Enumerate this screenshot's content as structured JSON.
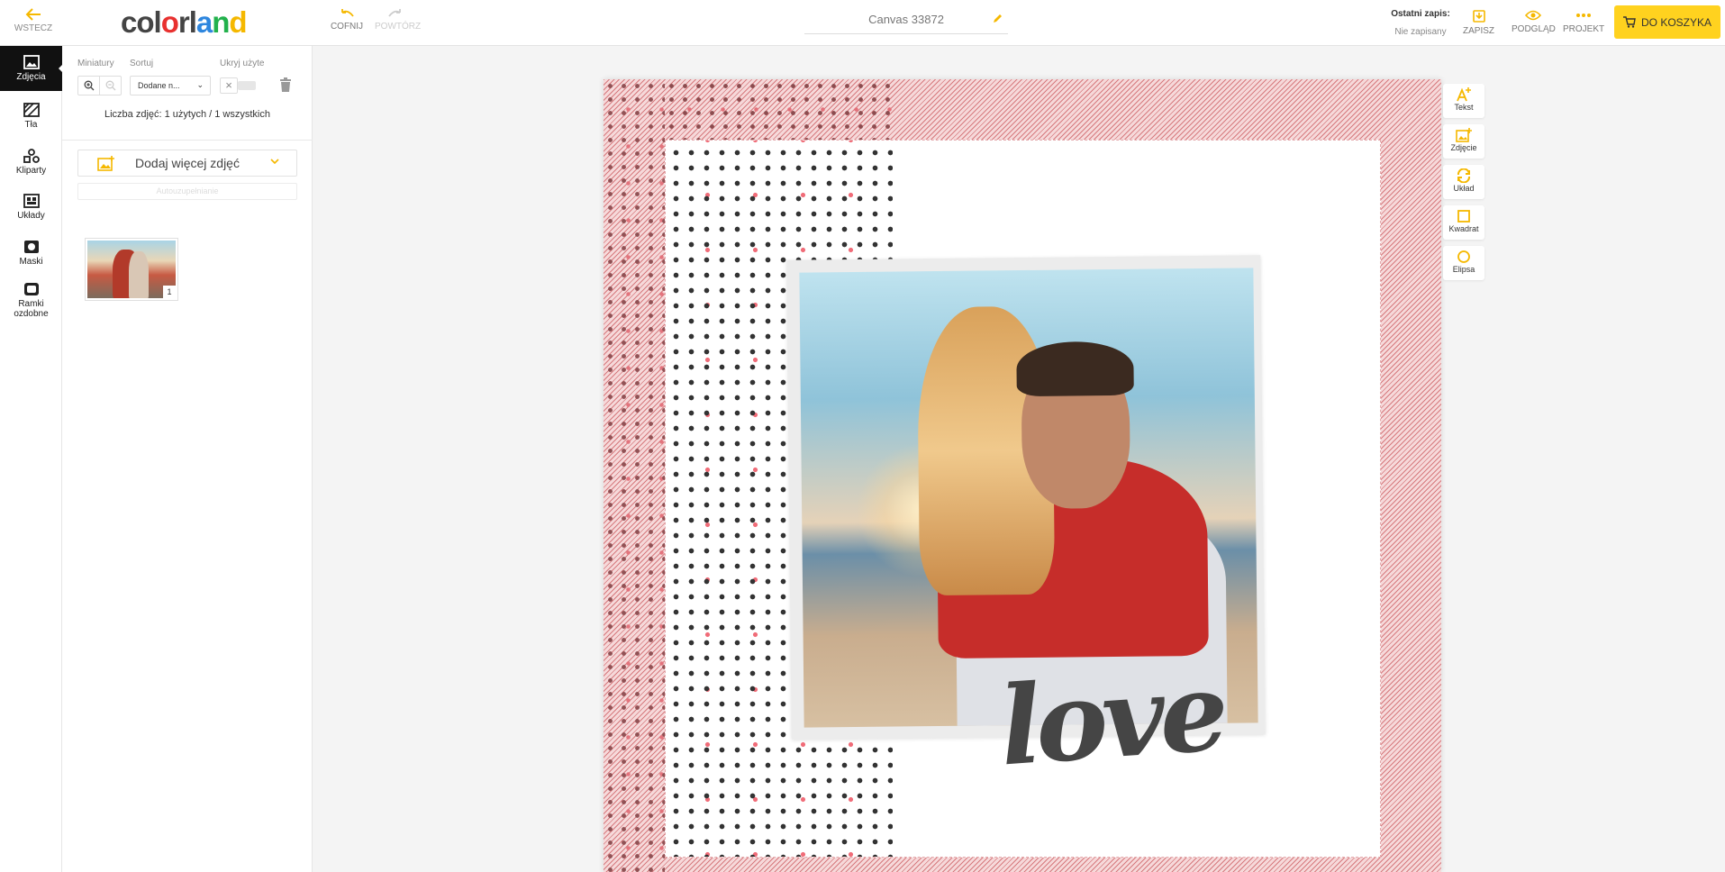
{
  "header": {
    "back_label": "WSTECZ",
    "logo": {
      "c1": "co",
      "o": "l",
      "c2": "o",
      "r": "r",
      "l": "l",
      "a": "a",
      "n": "n",
      "d": "d"
    },
    "undo_label": "COFNIJ",
    "redo_label": "POWTÓRZ",
    "canvas_name": "Canvas 33872",
    "last_save_title": "Ostatni zapis:",
    "last_save_value": "Nie zapisany",
    "save_label": "ZAPISZ",
    "preview_label": "PODGLĄD",
    "project_label": "PROJEKT",
    "cart_label": "DO KOSZYKA"
  },
  "sidebar": {
    "items": [
      {
        "label": "Zdjęcia",
        "icon": "image-icon",
        "active": true
      },
      {
        "label": "Tła",
        "icon": "background-icon"
      },
      {
        "label": "Kliparty",
        "icon": "shapes-icon"
      },
      {
        "label": "Układy",
        "icon": "layout-icon"
      },
      {
        "label": "Maski",
        "icon": "mask-icon"
      },
      {
        "label_line1": "Ramki",
        "label_line2": "ozdobne",
        "icon": "frame-icon"
      }
    ]
  },
  "panel": {
    "thumbnails_label": "Miniatury",
    "sort_label": "Sortuj",
    "hide_used_label": "Ukryj użyte",
    "sort_value": "Dodane n...",
    "photo_count": "Liczba zdjęć: 1 użytych / 1 wszystkich",
    "add_photos_label": "Dodaj więcej zdjęć",
    "autofill_label": "Autouzupełnianie",
    "photos": [
      {
        "usage_count": "1"
      }
    ]
  },
  "canvas": {
    "decor_text": "love"
  },
  "tools": [
    {
      "label": "Tekst",
      "icon": "text-add-icon"
    },
    {
      "label": "Zdjęcie",
      "icon": "image-add-icon"
    },
    {
      "label": "Układ",
      "icon": "layout-refresh-icon"
    },
    {
      "label": "Kwadrat",
      "icon": "square-icon"
    },
    {
      "label": "Elipsa",
      "icon": "ellipse-icon"
    }
  ],
  "colors": {
    "accent": "#ffd21f",
    "logo_red": "#e8312f",
    "logo_blue": "#2e86de",
    "logo_green": "#22b14c",
    "logo_yellow": "#f5b800",
    "active_rail": "#111111"
  }
}
